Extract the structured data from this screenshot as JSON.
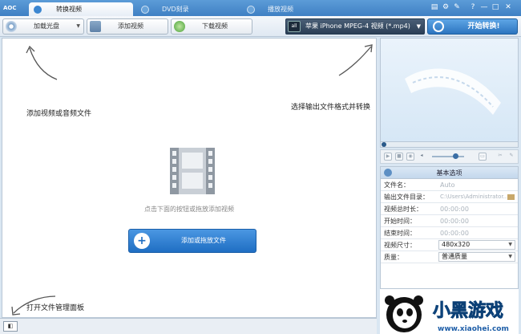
{
  "titlebar": {
    "logo": "AOC",
    "tabs": [
      {
        "label": "转换视频",
        "active": true
      },
      {
        "label": "DVD刻录",
        "active": false
      },
      {
        "label": "播放视频",
        "active": false
      }
    ],
    "controls": [
      "▤",
      "⚙",
      "✎",
      "?",
      "—",
      "□",
      "✕"
    ]
  },
  "toolbar": {
    "load_disc": "加载光盘",
    "add_video": "添加视频",
    "download_video": "下载视频",
    "format_icon": "all",
    "format_value": "苹果 iPhone MPEG-4 视频 (*.mp4)",
    "convert": "开始转换!"
  },
  "main": {
    "hint_add": "添加视频或音频文件",
    "hint_format": "选择输出文件格式并转换",
    "hint_panel": "打开文件管理面板",
    "drop_tip": "点击下面的按钮或拖放添加视频",
    "add_button": "添加或拖放文件"
  },
  "settings": {
    "header": "基本选项",
    "rows": [
      {
        "label": "文件名：",
        "value": "Auto"
      },
      {
        "label": "输出文件目录：",
        "value": "C:\\Users\\Administrator..."
      },
      {
        "label": "视频总时长：",
        "value": "00:00:00"
      },
      {
        "label": "开始时间：",
        "value": "00:00:00"
      },
      {
        "label": "结束时间：",
        "value": "00:00:00"
      },
      {
        "label": "视频尺寸：",
        "value": "480x320"
      },
      {
        "label": "质量：",
        "value": "普通质量"
      }
    ]
  },
  "watermark": {
    "text": "小黑游戏",
    "url": "www.xiaohei.com"
  },
  "colors": {
    "accent": "#2c74bf",
    "titlebar": "#4a8ccc"
  }
}
